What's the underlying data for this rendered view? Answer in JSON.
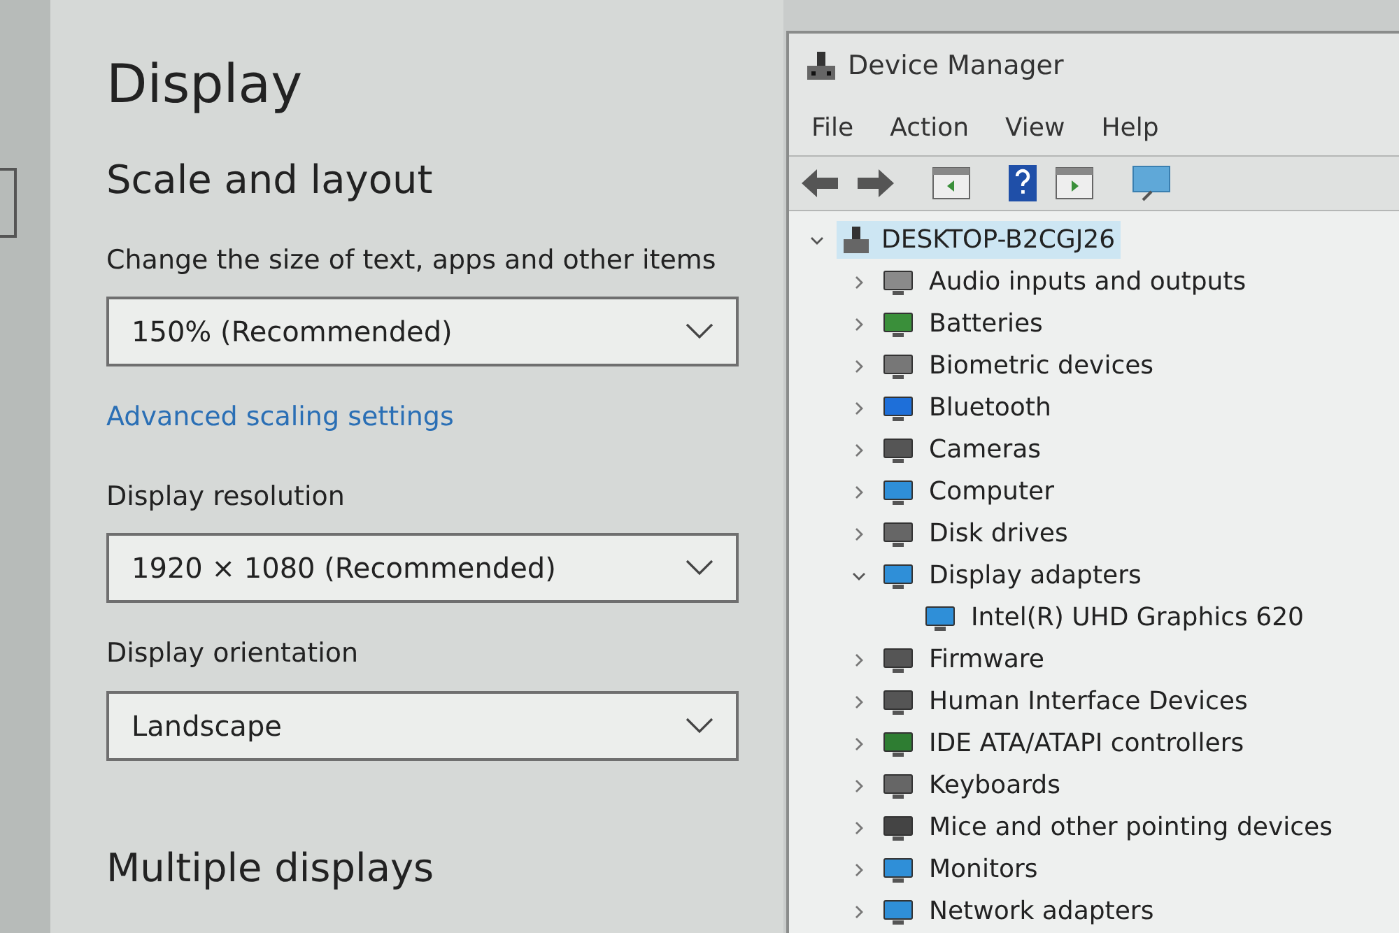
{
  "settings": {
    "title": "Display",
    "section": "Scale and layout",
    "scale": {
      "label": "Change the size of text, apps and other items",
      "value": "150% (Recommended)"
    },
    "link": "Advanced scaling settings",
    "resolution": {
      "label": "Display resolution",
      "value": "1920 × 1080 (Recommended)"
    },
    "orientation": {
      "label": "Display orientation",
      "value": "Landscape"
    },
    "next_section": "Multiple displays"
  },
  "device_manager": {
    "title": "Device Manager",
    "menu": [
      "File",
      "Action",
      "View",
      "Help"
    ],
    "tree": {
      "label": "DESKTOP-B2CGJ26",
      "expanded": true,
      "selected": true,
      "children": [
        {
          "label": "Audio inputs and outputs",
          "expanded": false
        },
        {
          "label": "Batteries",
          "expanded": false
        },
        {
          "label": "Biometric devices",
          "expanded": false
        },
        {
          "label": "Bluetooth",
          "expanded": false
        },
        {
          "label": "Cameras",
          "expanded": false
        },
        {
          "label": "Computer",
          "expanded": false
        },
        {
          "label": "Disk drives",
          "expanded": false
        },
        {
          "label": "Display adapters",
          "expanded": true,
          "children": [
            {
              "label": "Intel(R) UHD Graphics 620"
            }
          ]
        },
        {
          "label": "Firmware",
          "expanded": false
        },
        {
          "label": "Human Interface Devices",
          "expanded": false
        },
        {
          "label": "IDE ATA/ATAPI controllers",
          "expanded": false
        },
        {
          "label": "Keyboards",
          "expanded": false
        },
        {
          "label": "Mice and other pointing devices",
          "expanded": false
        },
        {
          "label": "Monitors",
          "expanded": false
        },
        {
          "label": "Network adapters",
          "expanded": false
        }
      ]
    }
  }
}
